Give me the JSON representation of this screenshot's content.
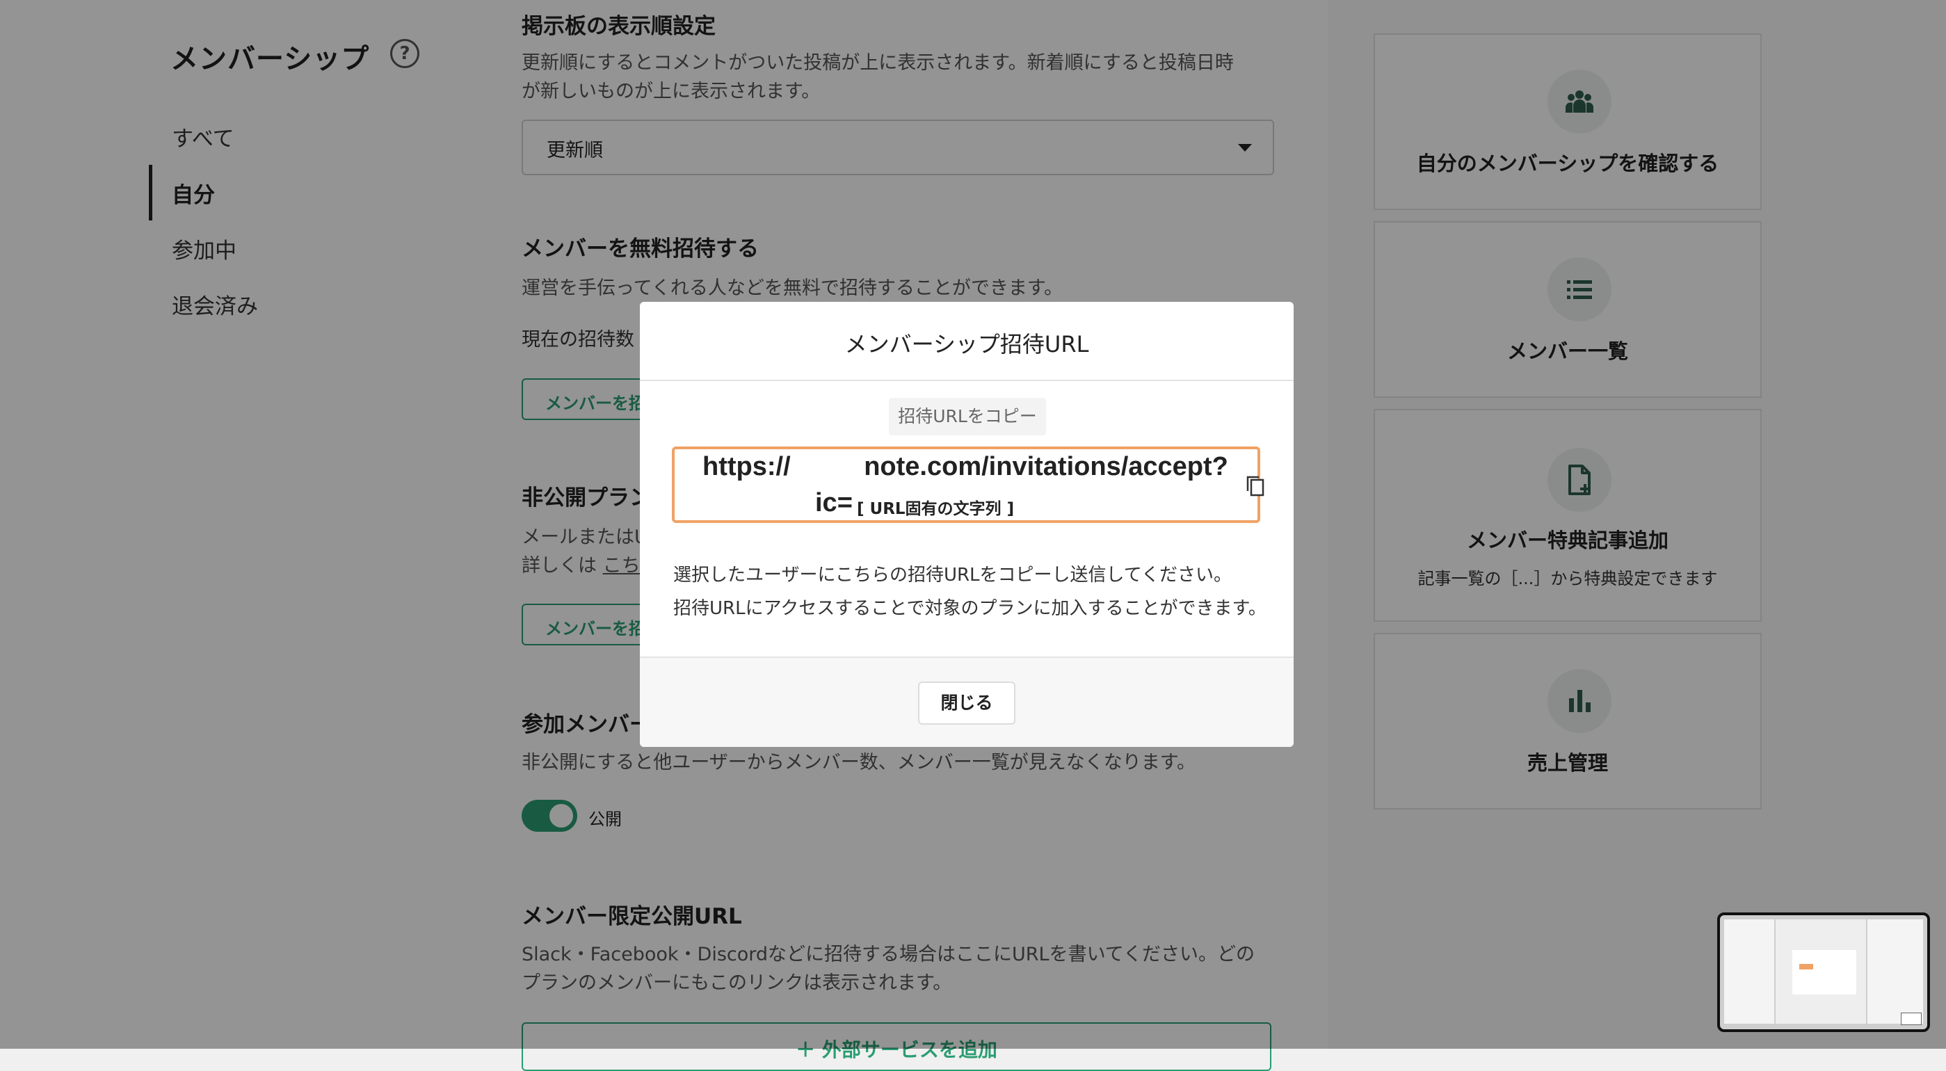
{
  "nav": {
    "title": "メンバーシップ",
    "help_icon": "?",
    "items": [
      {
        "label": "すべて",
        "active": false
      },
      {
        "label": "自分",
        "active": true
      },
      {
        "label": "参加中",
        "active": false
      },
      {
        "label": "退会済み",
        "active": false
      }
    ]
  },
  "content": {
    "board_order": {
      "title": "掲示板の表示順設定",
      "desc_line1": "更新順にするとコメントがついた投稿が上に表示されます。新着順にすると投稿日時",
      "desc_line2": "が新しいものが上に表示されます。",
      "select_value": "更新順"
    },
    "free_invite": {
      "title": "メンバーを無料招待する",
      "desc": "運営を手伝ってくれる人などを無料で招待することができます。",
      "current_count_label": "現在の招待数",
      "button": "メンバーを招"
    },
    "private_plan": {
      "title": "非公開プラン",
      "desc_line1": "メールまたはU",
      "desc_line2": "詳しくは",
      "link": "こち",
      "button": "メンバーを招"
    },
    "member_count": {
      "title": "参加メンバー",
      "desc": "非公開にすると他ユーザーからメンバー数、メンバー一覧が見えなくなります。",
      "toggle_label": "公開",
      "toggle_on": true
    },
    "limited_url": {
      "title": "メンバー限定公開URL",
      "desc_line1": "Slack・Facebook・Discordなどに招待する場合はここにURLを書いてください。どの",
      "desc_line2": "プランのメンバーにもこのリンクは表示されます。",
      "button": "＋ 外部サービスを追加"
    }
  },
  "cards": [
    {
      "icon": "group-icon",
      "label": "自分のメンバーシップを確認する",
      "sub": ""
    },
    {
      "icon": "list-icon",
      "label": "メンバー一覧",
      "sub": ""
    },
    {
      "icon": "file-add-icon",
      "label": "メンバー特典記事追加",
      "sub": "記事一覧の［...］から特典設定できます"
    },
    {
      "icon": "bar-chart-icon",
      "label": "売上管理",
      "sub": ""
    }
  ],
  "modal": {
    "title": "メンバーシップ招待URL",
    "copy_chip": "招待URLをコピー",
    "url_line1_prefix": "https://",
    "url_line1_rest": "note.com/invitations/accept?",
    "url_line2_param": "ic=",
    "url_line2_placeholder": "[ URL固有の文字列 ]",
    "text_line1": "選択したユーザーにこちらの招待URLをコピーし送信してください。",
    "text_line2": "招待URLにアクセスすることで対象のプランに加入することができます。",
    "close_button": "閉じる"
  },
  "colors": {
    "accent": "#2a9d72",
    "url_border": "#f0a265",
    "overlay": "rgba(0,0,0,0.42)"
  }
}
